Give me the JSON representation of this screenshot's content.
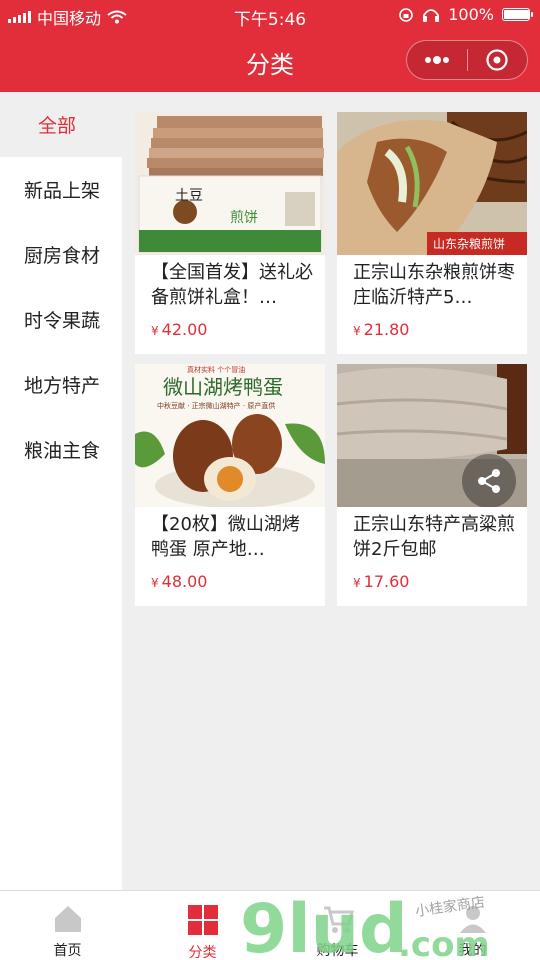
{
  "status_bar": {
    "carrier": "中国移动",
    "time": "下午5:46",
    "battery": "100%",
    "battery_level": 1.0
  },
  "nav": {
    "title": "分类",
    "more_icon": "more-dots-icon",
    "close_icon": "target-circle-icon"
  },
  "categories": [
    {
      "label": "全部",
      "active": true
    },
    {
      "label": "新品上架",
      "active": false
    },
    {
      "label": "厨房食材",
      "active": false
    },
    {
      "label": "时令果蔬",
      "active": false
    },
    {
      "label": "地方特产",
      "active": false
    },
    {
      "label": "粮油主食",
      "active": false
    }
  ],
  "products": [
    {
      "name": "【全国首发】送礼必备煎饼礼盒！…",
      "currency": "¥",
      "price": "42.00",
      "box_text": "土豆",
      "box_sub": "煎饼"
    },
    {
      "name": "正宗山东杂粮煎饼枣庄临沂特产5…",
      "currency": "¥",
      "price": "21.80",
      "tag": "山东杂粮煎饼"
    },
    {
      "name": "【20枚】微山湖烤鸭蛋 原产地…",
      "currency": "¥",
      "price": "48.00",
      "banner": "微山湖烤鸭蛋",
      "banner_top": "真材实料 个个冒油",
      "banner_sub": "中秋豆献 · 正宗微山湖特产 · 原产直供"
    },
    {
      "name": "正宗山东特产高粱煎饼2斤包邮",
      "currency": "¥",
      "price": "17.60"
    }
  ],
  "tabbar": [
    {
      "label": "首页",
      "icon": "home-icon",
      "active": false
    },
    {
      "label": "分类",
      "icon": "category-grid-icon",
      "active": true
    },
    {
      "label": "购物车",
      "icon": "cart-icon",
      "active": false
    },
    {
      "label": "我的",
      "icon": "user-icon",
      "active": false
    }
  ],
  "watermark": {
    "main": "9lud",
    "tld": ".com",
    "shop": "小桂家商店"
  },
  "colors": {
    "brand": "#e12e3a",
    "sidebar_active_bg": "#efefef",
    "background": "#efefef"
  }
}
